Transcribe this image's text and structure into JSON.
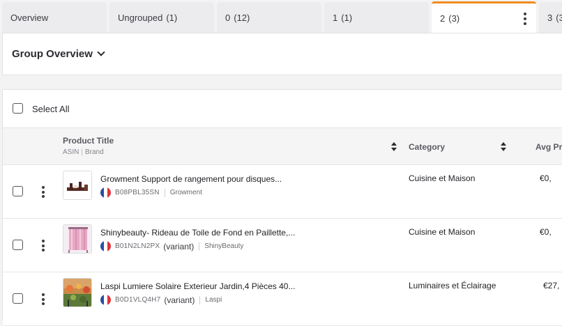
{
  "tabs": [
    {
      "label": "Overview",
      "count": "",
      "active": false
    },
    {
      "label": "Ungrouped",
      "count": "(1)",
      "active": false
    },
    {
      "label": "0",
      "count": "(12)",
      "active": false
    },
    {
      "label": "1",
      "count": "(1)",
      "active": false
    },
    {
      "label": "2",
      "count": "(3)",
      "active": true
    },
    {
      "label": "3",
      "count": "(3",
      "active": false
    }
  ],
  "group": {
    "title": "Group Overview"
  },
  "table": {
    "select_all": "Select All",
    "headers": {
      "product_title": "Product Title",
      "asin": "ASIN",
      "brand": "Brand",
      "category": "Category",
      "avg_price": "Avg Pr"
    },
    "rows": [
      {
        "title": "Growment Support de rangement pour disques...",
        "asin": "B08PBL35SN",
        "variant": "",
        "brand": "Growment",
        "category": "Cuisine et Maison",
        "price": "€0,"
      },
      {
        "title": "Shinybeauty- Rideau de Toile de Fond en Paillette,...",
        "asin": "B01N2LN2PX",
        "variant": "(variant)",
        "brand": "ShinyBeauty",
        "category": "Cuisine et Maison",
        "price": "€0,"
      },
      {
        "title": "Laspi Lumiere Solaire Exterieur Jardin,4 Pièces 40...",
        "asin": "B0D1VLQ4H7",
        "variant": "(variant)",
        "brand": "Laspi",
        "category": "Luminaires et Éclairage",
        "price": "€27,"
      }
    ]
  },
  "colors": {
    "accent": "#f28b1e",
    "flag_blue": "#2b4ea2",
    "flag_white": "#ffffff",
    "flag_red": "#e0333b"
  }
}
